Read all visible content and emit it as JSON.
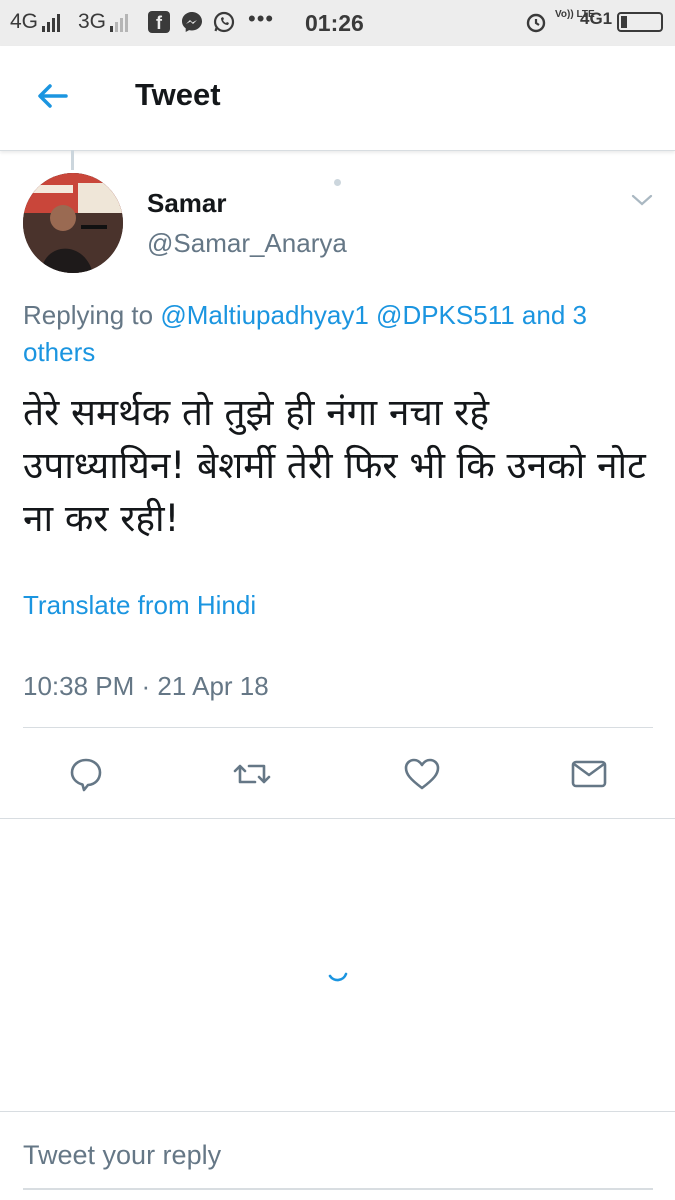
{
  "status_bar": {
    "network1": "4G",
    "network2": "3G",
    "time": "01:26",
    "volte": "Vo)) LTE",
    "network3": "4G1",
    "icons": [
      "signal-icon",
      "facebook-icon",
      "messenger-icon",
      "whatsapp-icon",
      "more-dots-icon",
      "alarm-icon",
      "battery-icon"
    ]
  },
  "header": {
    "title": "Tweet",
    "back_icon": "arrow-left-icon"
  },
  "tweet": {
    "author_name": "Samar",
    "author_handle": "@Samar_Anarya",
    "replying_prefix": "Replying to ",
    "replying_mentions": "@Maltiupadhyay1 @DPKS511 and 3 others",
    "text": "तेरे समर्थक तो तुझे ही नंगा नचा रहे उपाध्यायिन! बेशर्मी तेरी फिर भी कि उनको नोट ना कर रही!",
    "translate_label": "Translate from Hindi",
    "timestamp": "10:38 PM · 21 Apr 18"
  },
  "actions": [
    "reply-icon",
    "retweet-icon",
    "like-icon",
    "direct-message-icon"
  ],
  "reply_box": {
    "placeholder": "Tweet your reply"
  },
  "colors": {
    "accent": "#1b95e0",
    "secondary_text": "#657786",
    "primary_text": "#14171a",
    "status_bar_bg": "#ededed"
  }
}
